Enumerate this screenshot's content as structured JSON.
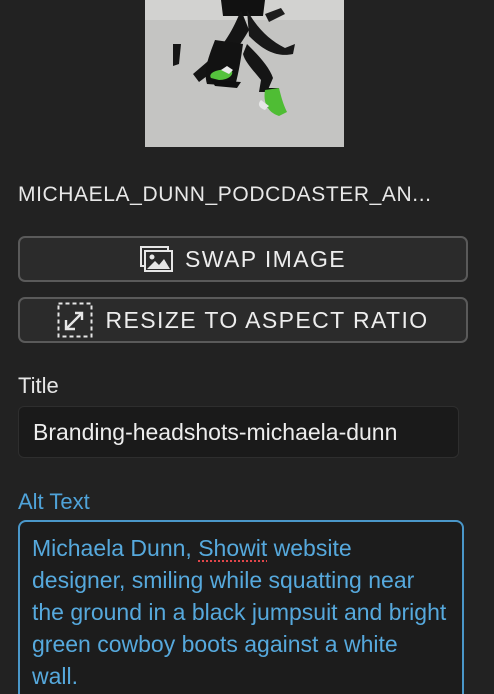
{
  "image": {
    "filename": "MICHAELA_DUNN_PODCDASTER_AN..."
  },
  "buttons": {
    "swap_label": "SWAP IMAGE",
    "swap_icon": "image-icon",
    "resize_label": "RESIZE TO ASPECT RATIO",
    "resize_icon": "resize-icon"
  },
  "fields": {
    "title_label": "Title",
    "title_value": "Branding-headshots-michaela-dunn",
    "alt_label": "Alt Text",
    "alt_before": "Michaela Dunn, ",
    "alt_flagged": "Showit",
    "alt_after": " website designer, smiling while squatting near the ground in a black jumpsuit and bright green cowboy boots against a white wall."
  },
  "colors": {
    "background": "#222222",
    "accent_blue": "#4fa3d9",
    "button_border": "#5a5a5a",
    "spellcheck": "#e0464a"
  }
}
